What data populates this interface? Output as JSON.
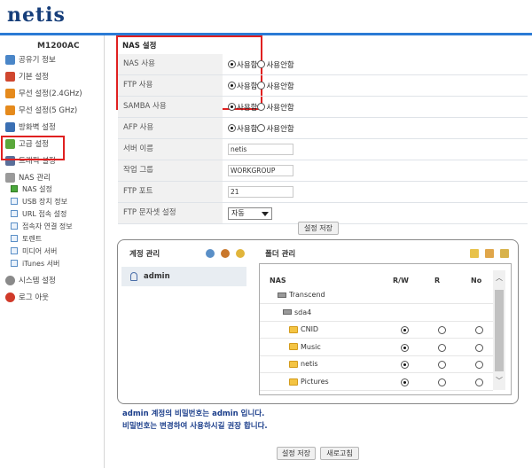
{
  "brand": "netis",
  "sidebar": {
    "model": "M1200AC",
    "items": [
      {
        "label": "공유기 정보",
        "icon": "router-info-icon",
        "color": "#4a86c8"
      },
      {
        "label": "기본 설정",
        "icon": "basic-settings-icon",
        "color": "#d0472f"
      },
      {
        "label": "무선 설정(2.4GHz)",
        "icon": "wifi-icon",
        "color": "#e58a1c"
      },
      {
        "label": "무선 설정(5 GHz)",
        "icon": "wifi-icon",
        "color": "#e58a1c"
      },
      {
        "label": "방화벽 설정",
        "icon": "firewall-icon",
        "color": "#3a6fb3"
      },
      {
        "label": "고급 설정",
        "icon": "advanced-icon",
        "color": "#5aa83b"
      },
      {
        "label": "트래픽 설정",
        "icon": "traffic-icon",
        "color": "#5a6f9a"
      },
      {
        "label": "NAS 관리",
        "icon": "nas-icon",
        "color": "#9a9a9a"
      }
    ],
    "sub_items": [
      {
        "label": "NAS 설정",
        "icon": "check-icon"
      },
      {
        "label": "USB 장치 정보",
        "icon": "page-icon"
      },
      {
        "label": "URL 접속 설정",
        "icon": "page-icon"
      },
      {
        "label": "접속자 연결 정보",
        "icon": "page-icon"
      },
      {
        "label": "토렌트",
        "icon": "page-icon"
      },
      {
        "label": "미디어 서버",
        "icon": "page-icon"
      },
      {
        "label": "iTunes 서버",
        "icon": "page-icon"
      }
    ],
    "bottom_items": [
      {
        "label": "시스템 설정",
        "icon": "gear-icon",
        "color": "#8a8a8a"
      },
      {
        "label": "로그 아웃",
        "icon": "logout-icon",
        "color": "#d03a2a"
      }
    ]
  },
  "main": {
    "section_title": "NAS 설정",
    "radio_on": "사용함",
    "radio_off": "사용안함",
    "rows": [
      {
        "label": "NAS 사용",
        "selected": "on"
      },
      {
        "label": "FTP 사용",
        "selected": "on"
      },
      {
        "label": "SAMBA 사용",
        "selected": "on"
      },
      {
        "label": "AFP 사용",
        "selected": "on"
      }
    ],
    "server_name_label": "서버 이름",
    "server_name_value": "netis",
    "workgroup_label": "작업 그룹",
    "workgroup_value": "WORKGROUP",
    "ftp_port_label": "FTP 포트",
    "ftp_port_value": "21",
    "charset_label": "FTP 문자셋 설정",
    "charset_value": "자동",
    "save_label": "설정 저장"
  },
  "panel": {
    "account_title": "계정 관리",
    "folder_title": "폴더 관리",
    "account_name": "admin",
    "columns": [
      "NAS",
      "R/W",
      "R",
      "No"
    ],
    "tree": [
      {
        "name": "Transcend",
        "type": "drive",
        "level": 1
      },
      {
        "name": "sda4",
        "type": "drive",
        "level": 2
      },
      {
        "name": "CNID",
        "type": "folder",
        "level": 3,
        "perm": "rw"
      },
      {
        "name": "Music",
        "type": "folder",
        "level": 3,
        "perm": "rw"
      },
      {
        "name": "netis",
        "type": "folder",
        "level": 3,
        "perm": "rw"
      },
      {
        "name": "Pictures",
        "type": "folder",
        "level": 3,
        "perm": "rw"
      }
    ]
  },
  "notes": {
    "line1": "admin 계정의 비밀번호는 admin 입니다.",
    "line2": "비밀번호는 변경하여 사용하시길 권장 합니다."
  },
  "footer": {
    "save_label": "설정 저장",
    "refresh_label": "새로고침"
  }
}
